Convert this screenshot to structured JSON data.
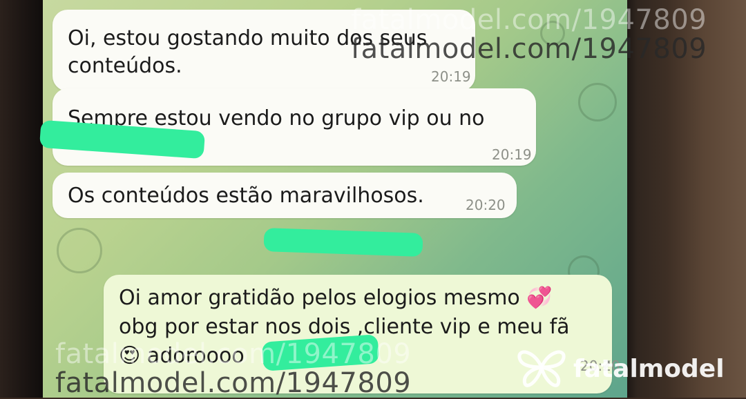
{
  "messages": [
    {
      "text_line1": "Oi, estou gostando muito dos seus",
      "text_line2": "conteúdos.",
      "time": "20:19"
    },
    {
      "text_line1": "Sempre estou vendo no grupo vip ou no",
      "time": "20:19"
    },
    {
      "text_line1": "Os conteúdos estão maravilhosos.",
      "time": "20:20"
    },
    {
      "text_line1": "Oi amor gratidão pelos elogios mesmo 💞",
      "text_line2": "obg por estar nos dois ,cliente vip e meu fã",
      "text_line3": "😍  adoroooo",
      "time": "20:20"
    }
  ],
  "watermark": {
    "url": "fatalmodel.com/1947809",
    "logo_text": "fatalmodel"
  },
  "colors": {
    "redaction": "#33ed9d",
    "bubble_incoming": "#fbfbf6",
    "bubble_outgoing": "#eef8d6"
  }
}
